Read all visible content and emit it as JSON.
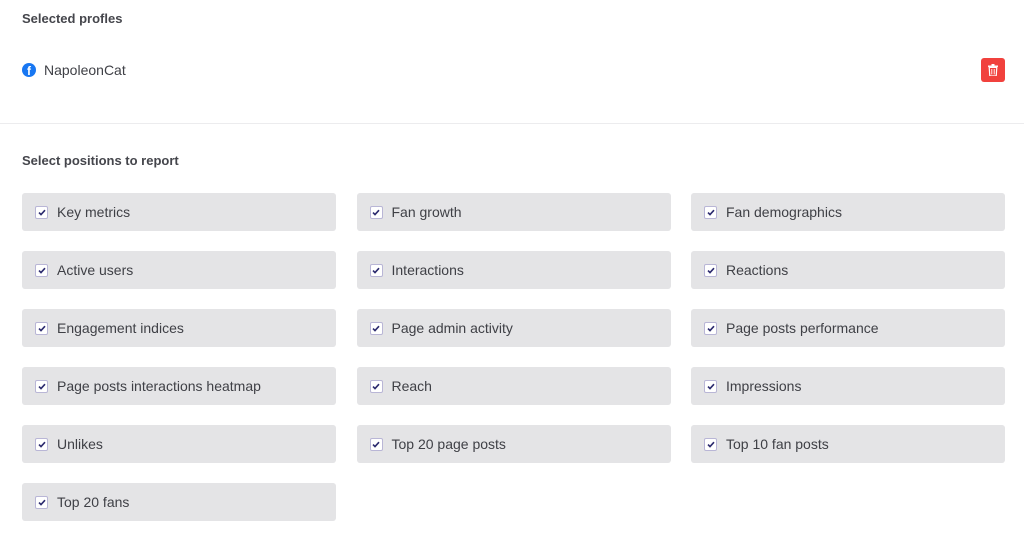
{
  "selected_profiles": {
    "title": "Selected profles",
    "profiles": [
      {
        "name": "NapoleonCat",
        "network": "facebook",
        "icon": "facebook-icon"
      }
    ],
    "delete_icon": "trash-icon",
    "colors": {
      "delete_bg": "#f1413d",
      "facebook": "#1877f2"
    }
  },
  "positions": {
    "title": "Select positions to report",
    "items": [
      {
        "label": "Key metrics",
        "checked": true
      },
      {
        "label": "Fan growth",
        "checked": true
      },
      {
        "label": "Fan demographics",
        "checked": true
      },
      {
        "label": "Active users",
        "checked": true
      },
      {
        "label": "Interactions",
        "checked": true
      },
      {
        "label": "Reactions",
        "checked": true
      },
      {
        "label": "Engagement indices",
        "checked": true
      },
      {
        "label": "Page admin activity",
        "checked": true
      },
      {
        "label": "Page posts performance",
        "checked": true
      },
      {
        "label": "Page posts interactions heatmap",
        "checked": true
      },
      {
        "label": "Reach",
        "checked": true
      },
      {
        "label": "Impressions",
        "checked": true
      },
      {
        "label": "Unlikes",
        "checked": true
      },
      {
        "label": "Top 20 page posts",
        "checked": true
      },
      {
        "label": "Top 10 fan posts",
        "checked": true
      },
      {
        "label": "Top 20 fans",
        "checked": true
      }
    ]
  }
}
